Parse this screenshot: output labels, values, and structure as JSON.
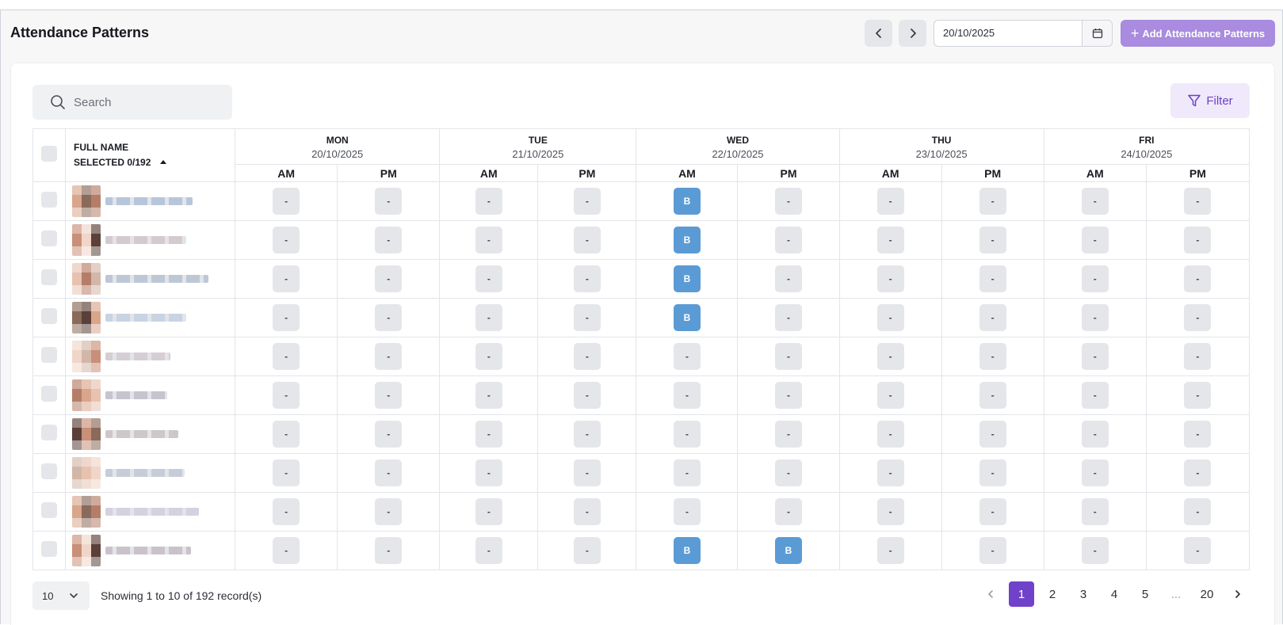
{
  "header": {
    "title": "Attendance Patterns",
    "date_value": "20/10/2025",
    "add_label": "Add Attendance Patterns"
  },
  "toolbar": {
    "search_placeholder": "Search",
    "filter_label": "Filter"
  },
  "table": {
    "name_header": "FULL NAME",
    "selected_label": "SELECTED 0/192",
    "days": [
      {
        "day": "MON",
        "date": "20/10/2025"
      },
      {
        "day": "TUE",
        "date": "21/10/2025"
      },
      {
        "day": "WED",
        "date": "22/10/2025"
      },
      {
        "day": "THU",
        "date": "23/10/2025"
      },
      {
        "day": "FRI",
        "date": "24/10/2025"
      }
    ],
    "slot_labels": [
      "AM",
      "PM"
    ],
    "empty_mark": "-",
    "rows": [
      {
        "slots": [
          "-",
          "-",
          "-",
          "-",
          "B",
          "-",
          "-",
          "-",
          "-",
          "-"
        ]
      },
      {
        "slots": [
          "-",
          "-",
          "-",
          "-",
          "B",
          "-",
          "-",
          "-",
          "-",
          "-"
        ]
      },
      {
        "slots": [
          "-",
          "-",
          "-",
          "-",
          "B",
          "-",
          "-",
          "-",
          "-",
          "-"
        ]
      },
      {
        "slots": [
          "-",
          "-",
          "-",
          "-",
          "B",
          "-",
          "-",
          "-",
          "-",
          "-"
        ]
      },
      {
        "slots": [
          "-",
          "-",
          "-",
          "-",
          "-",
          "-",
          "-",
          "-",
          "-",
          "-"
        ]
      },
      {
        "slots": [
          "-",
          "-",
          "-",
          "-",
          "-",
          "-",
          "-",
          "-",
          "-",
          "-"
        ]
      },
      {
        "slots": [
          "-",
          "-",
          "-",
          "-",
          "-",
          "-",
          "-",
          "-",
          "-",
          "-"
        ]
      },
      {
        "slots": [
          "-",
          "-",
          "-",
          "-",
          "-",
          "-",
          "-",
          "-",
          "-",
          "-"
        ]
      },
      {
        "slots": [
          "-",
          "-",
          "-",
          "-",
          "-",
          "-",
          "-",
          "-",
          "-",
          "-"
        ]
      },
      {
        "slots": [
          "-",
          "-",
          "-",
          "-",
          "B",
          "B",
          "-",
          "-",
          "-",
          "-"
        ]
      }
    ]
  },
  "footer": {
    "per_page": "10",
    "showing_text": "Showing 1 to 10 of 192 record(s)",
    "pages": [
      "1",
      "2",
      "3",
      "4",
      "5",
      "...",
      "20"
    ],
    "active_page": "1"
  },
  "colors": {
    "accent": "#7042c9",
    "booked": "#5b9bd5",
    "add_button": "#a98bdf"
  }
}
